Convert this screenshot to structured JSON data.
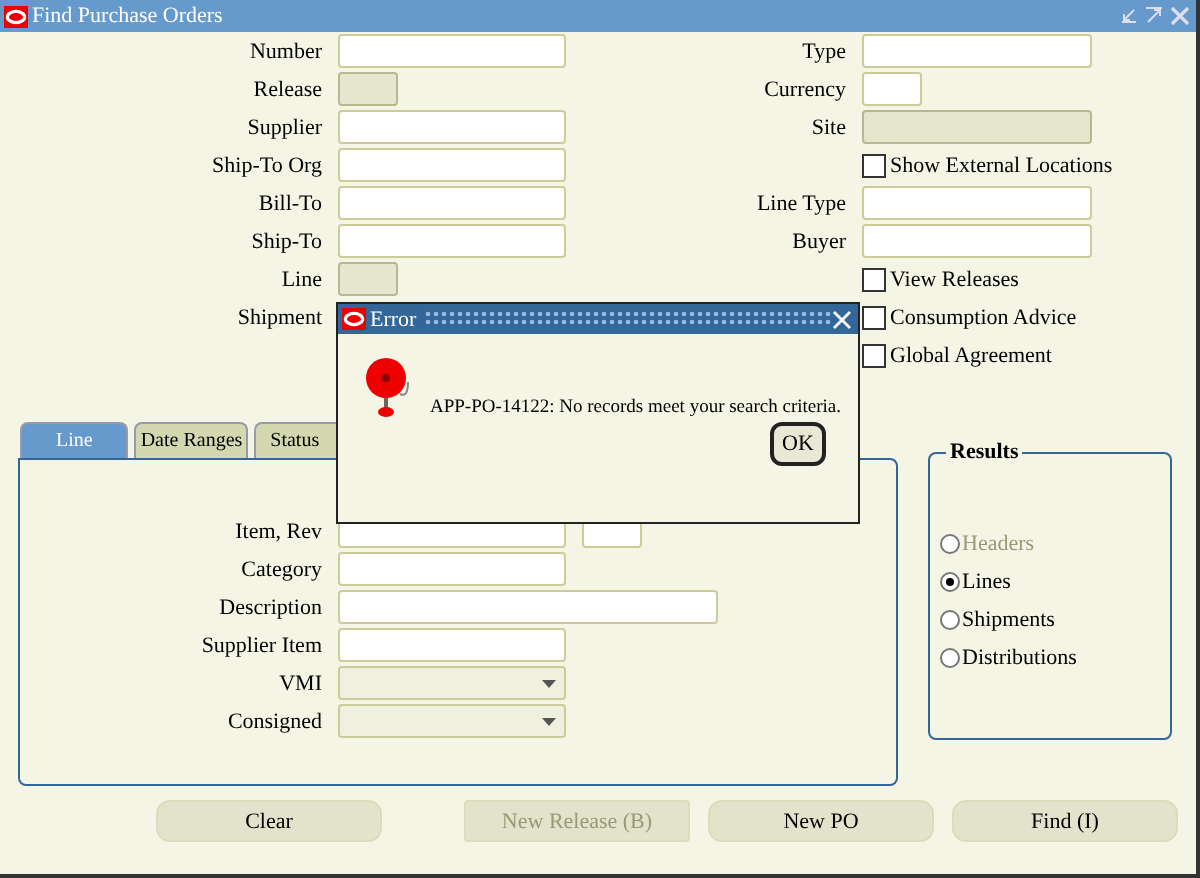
{
  "window": {
    "title": "Find Purchase Orders"
  },
  "left_fields": [
    {
      "label": "Number",
      "kind": "text",
      "disabled": false
    },
    {
      "label": "Release",
      "kind": "short",
      "disabled": true
    },
    {
      "label": "Supplier",
      "kind": "text",
      "disabled": false
    },
    {
      "label": "Ship-To Org",
      "kind": "text",
      "disabled": false
    },
    {
      "label": "Bill-To",
      "kind": "text",
      "disabled": false
    },
    {
      "label": "Ship-To",
      "kind": "text",
      "disabled": false
    },
    {
      "label": "Line",
      "kind": "short",
      "disabled": true
    },
    {
      "label": "Shipment",
      "kind": "label"
    }
  ],
  "right_fields": [
    {
      "label": "Type",
      "kind": "text",
      "disabled": false
    },
    {
      "label": "Currency",
      "kind": "short",
      "disabled": false
    },
    {
      "label": "Site",
      "kind": "text",
      "disabled": true
    },
    {
      "label": "Show External Locations",
      "kind": "checkbox",
      "checked": false
    },
    {
      "label": "Line Type",
      "kind": "text",
      "disabled": false
    },
    {
      "label": "Buyer",
      "kind": "text",
      "disabled": false
    },
    {
      "label": "View Releases",
      "kind": "checkbox",
      "checked": false
    },
    {
      "label": "Consumption Advice",
      "kind": "checkbox",
      "checked": false
    },
    {
      "label": "Global Agreement",
      "kind": "checkbox",
      "checked": false
    }
  ],
  "tabs": [
    {
      "label": "Line",
      "selected": true
    },
    {
      "label": "Date Ranges",
      "selected": false
    },
    {
      "label": "Status",
      "selected": false
    }
  ],
  "line_fields": [
    {
      "label": "Item, Rev",
      "kind": "pair"
    },
    {
      "label": "Category",
      "kind": "text"
    },
    {
      "label": "Description",
      "kind": "wide"
    },
    {
      "label": "Supplier Item",
      "kind": "text"
    },
    {
      "label": "VMI",
      "kind": "dropdown"
    },
    {
      "label": "Consigned",
      "kind": "dropdown"
    }
  ],
  "results": {
    "title": "Results",
    "options": [
      {
        "label": "Headers",
        "selected": false,
        "disabled": true
      },
      {
        "label": "Lines",
        "selected": true,
        "disabled": false
      },
      {
        "label": "Shipments",
        "selected": false,
        "disabled": false
      },
      {
        "label": "Distributions",
        "selected": false,
        "disabled": false
      }
    ]
  },
  "buttons": [
    {
      "label": "Clear",
      "disabled": false
    },
    {
      "label": "New Release (B)",
      "disabled": true
    },
    {
      "label": "New PO",
      "disabled": false
    },
    {
      "label": "Find (I)",
      "disabled": false
    }
  ],
  "dialog": {
    "title": "Error",
    "message": "APP-PO-14122: No records meet your search criteria.",
    "button": "OK"
  }
}
